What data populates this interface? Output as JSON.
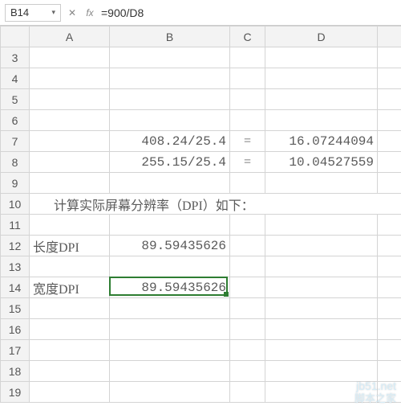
{
  "namebox": {
    "cell_ref": "B14",
    "dropdown_glyph": "▾"
  },
  "formula_bar": {
    "cancel_glyph": "✕",
    "fx_label": "fx",
    "formula": "=900/D8"
  },
  "columns": [
    "A",
    "B",
    "C",
    "D",
    "E"
  ],
  "rows_start": 3,
  "rows_end": 19,
  "cells": {
    "B7": "408.24/25.4",
    "C7": "=",
    "D7": "16.07244094",
    "B8": "255.15/25.4",
    "C8": "=",
    "D8": "10.04527559",
    "A10_merged": "计算实际屏幕分辨率（DPI）如下：",
    "A12": "长度DPI",
    "B12": "89.59435626",
    "A14": "宽度DPI",
    "B14": "89.59435626"
  },
  "active": {
    "col": "B",
    "row": 14
  },
  "watermark": {
    "line1": "jb51.net",
    "line2": "脚本之家"
  }
}
